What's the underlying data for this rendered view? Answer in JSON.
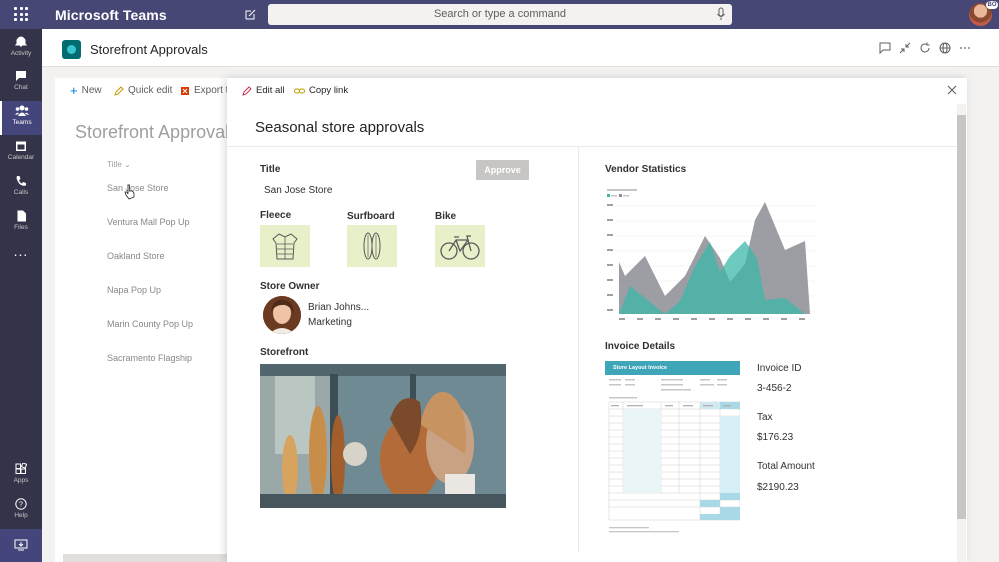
{
  "top": {
    "app_name": "Microsoft Teams",
    "search_placeholder": "Search or type a command",
    "avatar_badge": "BO"
  },
  "rail": [
    {
      "label": "Activity",
      "icon": "bell-icon"
    },
    {
      "label": "Chat",
      "icon": "chat-icon"
    },
    {
      "label": "Teams",
      "icon": "teams-icon",
      "active": true
    },
    {
      "label": "Calendar",
      "icon": "calendar-icon"
    },
    {
      "label": "Calls",
      "icon": "phone-icon"
    },
    {
      "label": "Files",
      "icon": "file-icon"
    },
    {
      "label": "...",
      "icon": "more-icon"
    },
    {
      "label": "Apps",
      "icon": "apps-icon"
    },
    {
      "label": "Help",
      "icon": "help-icon"
    }
  ],
  "header": {
    "title": "Storefront Approvals"
  },
  "sp": {
    "cmd_new": "New",
    "cmd_quick_edit": "Quick edit",
    "cmd_export": "Export t",
    "title": "Storefront Approvals",
    "column_title": "Title",
    "rows": [
      "San Jose Store",
      "Ventura Mall Pop Up",
      "Oakland Store",
      "Napa Pop Up",
      "Marin County Pop Up",
      "Sacramento Flagship"
    ]
  },
  "panel": {
    "cmd_edit_all": "Edit all",
    "cmd_copy_link": "Copy link",
    "title": "Seasonal store approvals",
    "title_label": "Title",
    "title_value": "San Jose Store",
    "approve_label": "Approve",
    "products": [
      {
        "label": "Fleece",
        "icon": "jacket-icon"
      },
      {
        "label": "Surfboard",
        "icon": "surfboard-icon"
      },
      {
        "label": "Bike",
        "icon": "bike-icon"
      }
    ],
    "owner_label": "Store Owner",
    "owner_name": "Brian Johns...",
    "owner_dept": "Marketing",
    "storefront_label": "Storefront",
    "vendor_stats_label": "Vendor Statistics",
    "invoice_details_label": "Invoice Details",
    "invoice_doc_title": "Store Layout Invoice",
    "invoice_id_label": "Invoice ID",
    "invoice_id": "3-456-2",
    "tax_label": "Tax",
    "tax": "$176.23",
    "total_label": "Total Amount",
    "total": "$2190.23"
  },
  "colors": {
    "teams_purple": "#464775",
    "rail": "#33344a",
    "tile_bg": "#e8f0c9",
    "chart_teal": "#3cb8a8",
    "chart_gray": "#8c8c94"
  }
}
